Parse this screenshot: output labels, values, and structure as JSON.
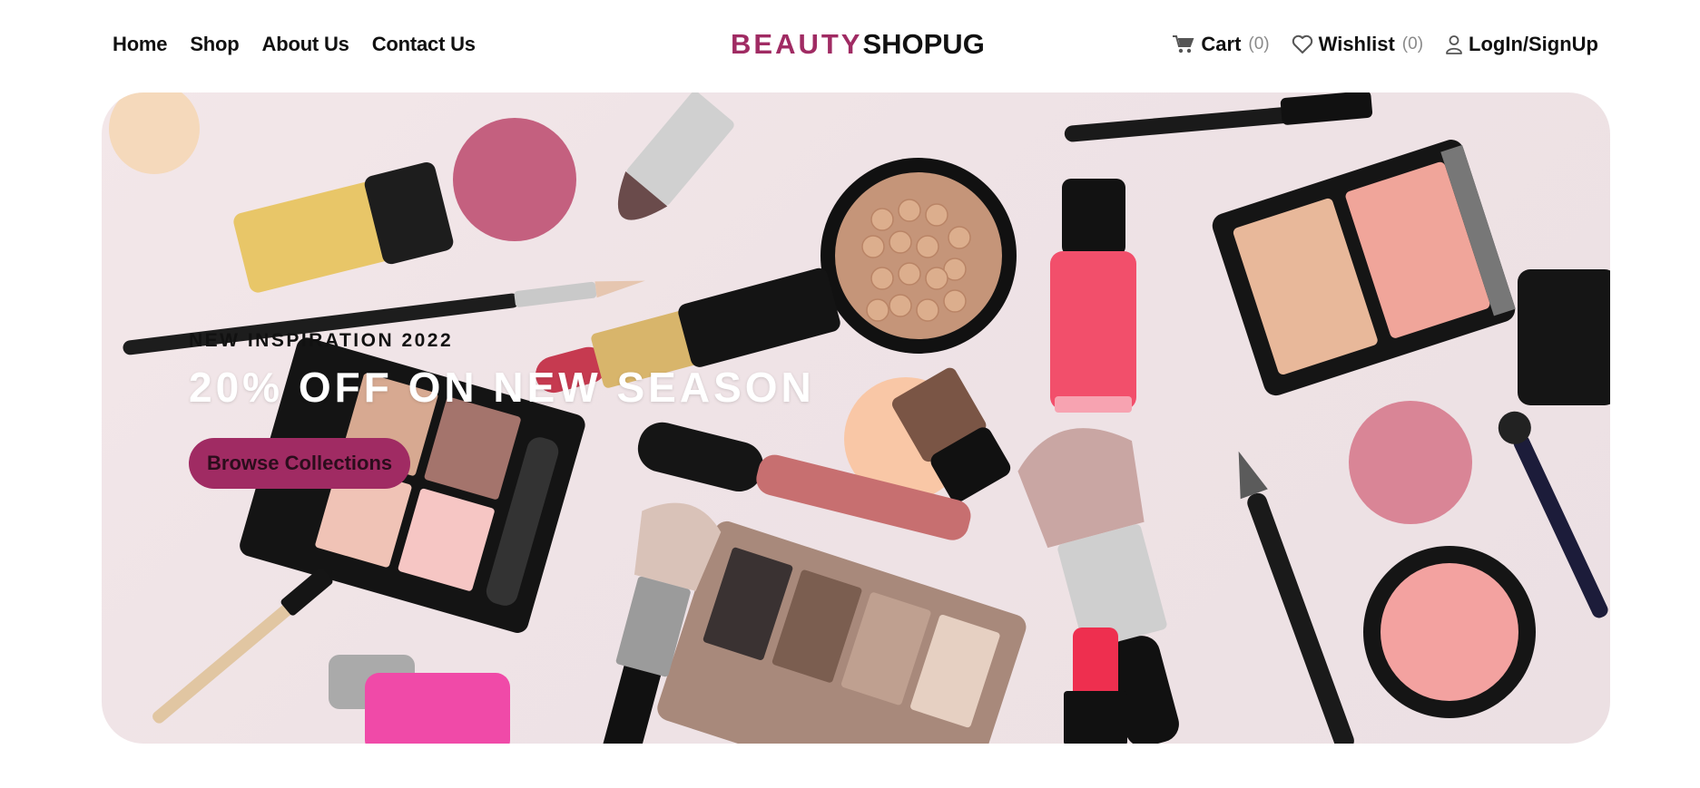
{
  "nav": {
    "items": [
      {
        "label": "Home"
      },
      {
        "label": "Shop"
      },
      {
        "label": "About Us"
      },
      {
        "label": "Contact Us"
      }
    ]
  },
  "brand": {
    "part1": "BEAUTY",
    "part2": "SHOPUG",
    "accent_color": "#a02b63"
  },
  "actions": {
    "cart": {
      "label": "Cart",
      "count": "(0)",
      "icon": "cart-icon"
    },
    "wishlist": {
      "label": "Wishlist",
      "count": "(0)",
      "icon": "heart-icon"
    },
    "login": {
      "label": "LogIn/SignUp",
      "icon": "user-icon"
    }
  },
  "hero": {
    "eyebrow": "NEW INSPIRATION 2022",
    "headline": "20% OFF ON NEW SEASON",
    "cta_label": "Browse Collections",
    "cta_color": "#a02b63"
  }
}
